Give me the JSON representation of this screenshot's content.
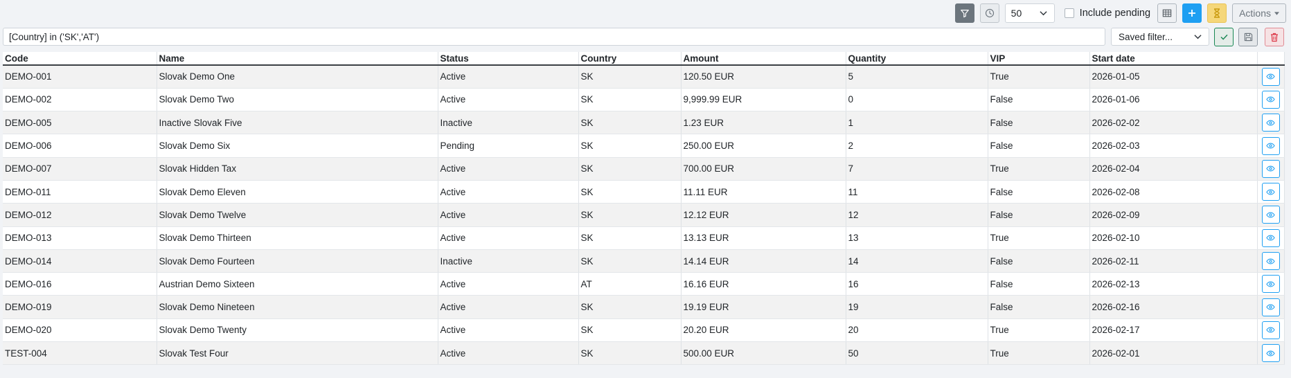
{
  "toolbar": {
    "page_size": "50",
    "include_pending_label": "Include pending",
    "include_pending_checked": false,
    "actions_label": "Actions"
  },
  "filter": {
    "expression": "[Country] in ('SK','AT')",
    "saved_filter_placeholder": "Saved filter..."
  },
  "table": {
    "columns": [
      "Code",
      "Name",
      "Status",
      "Country",
      "Amount",
      "Quantity",
      "VIP",
      "Start date"
    ],
    "rows": [
      [
        "DEMO-001",
        "Slovak Demo One",
        "Active",
        "SK",
        "120.50 EUR",
        "5",
        "True",
        "2026-01-05"
      ],
      [
        "DEMO-002",
        "Slovak Demo Two",
        "Active",
        "SK",
        "9,999.99 EUR",
        "0",
        "False",
        "2026-01-06"
      ],
      [
        "DEMO-005",
        "Inactive Slovak Five",
        "Inactive",
        "SK",
        "1.23 EUR",
        "1",
        "False",
        "2026-02-02"
      ],
      [
        "DEMO-006",
        "Slovak Demo Six",
        "Pending",
        "SK",
        "250.00 EUR",
        "2",
        "False",
        "2026-02-03"
      ],
      [
        "DEMO-007",
        "Slovak Hidden Tax",
        "Active",
        "SK",
        "700.00 EUR",
        "7",
        "True",
        "2026-02-04"
      ],
      [
        "DEMO-011",
        "Slovak Demo Eleven",
        "Active",
        "SK",
        "11.11 EUR",
        "11",
        "False",
        "2026-02-08"
      ],
      [
        "DEMO-012",
        "Slovak Demo Twelve",
        "Active",
        "SK",
        "12.12 EUR",
        "12",
        "False",
        "2026-02-09"
      ],
      [
        "DEMO-013",
        "Slovak Demo Thirteen",
        "Active",
        "SK",
        "13.13 EUR",
        "13",
        "True",
        "2026-02-10"
      ],
      [
        "DEMO-014",
        "Slovak Demo Fourteen",
        "Inactive",
        "SK",
        "14.14 EUR",
        "14",
        "False",
        "2026-02-11"
      ],
      [
        "DEMO-016",
        "Austrian Demo Sixteen",
        "Active",
        "AT",
        "16.16 EUR",
        "16",
        "False",
        "2026-02-13"
      ],
      [
        "DEMO-019",
        "Slovak Demo Nineteen",
        "Active",
        "SK",
        "19.19 EUR",
        "19",
        "False",
        "2026-02-16"
      ],
      [
        "DEMO-020",
        "Slovak Demo Twenty",
        "Active",
        "SK",
        "20.20 EUR",
        "20",
        "True",
        "2026-02-17"
      ],
      [
        "TEST-004",
        "Slovak Test Four",
        "Active",
        "SK",
        "500.00 EUR",
        "50",
        "True",
        "2026-02-01"
      ]
    ]
  },
  "colors": {
    "accent_blue": "#1e9ff2",
    "filter_button": "#6c757d",
    "pending_button": "#f5d77a",
    "apply_green": "#198754",
    "delete_red": "#dc3545",
    "row_stripe": "#f2f2f2",
    "page_background": "#f1f3f6"
  },
  "icons": {
    "filter": "filter-icon",
    "history": "clock-icon",
    "table": "table-icon",
    "add": "plus-icon",
    "pending": "hourglass-icon",
    "apply": "check-icon",
    "save": "floppy-icon",
    "delete": "trash-icon",
    "view": "eye-icon"
  }
}
